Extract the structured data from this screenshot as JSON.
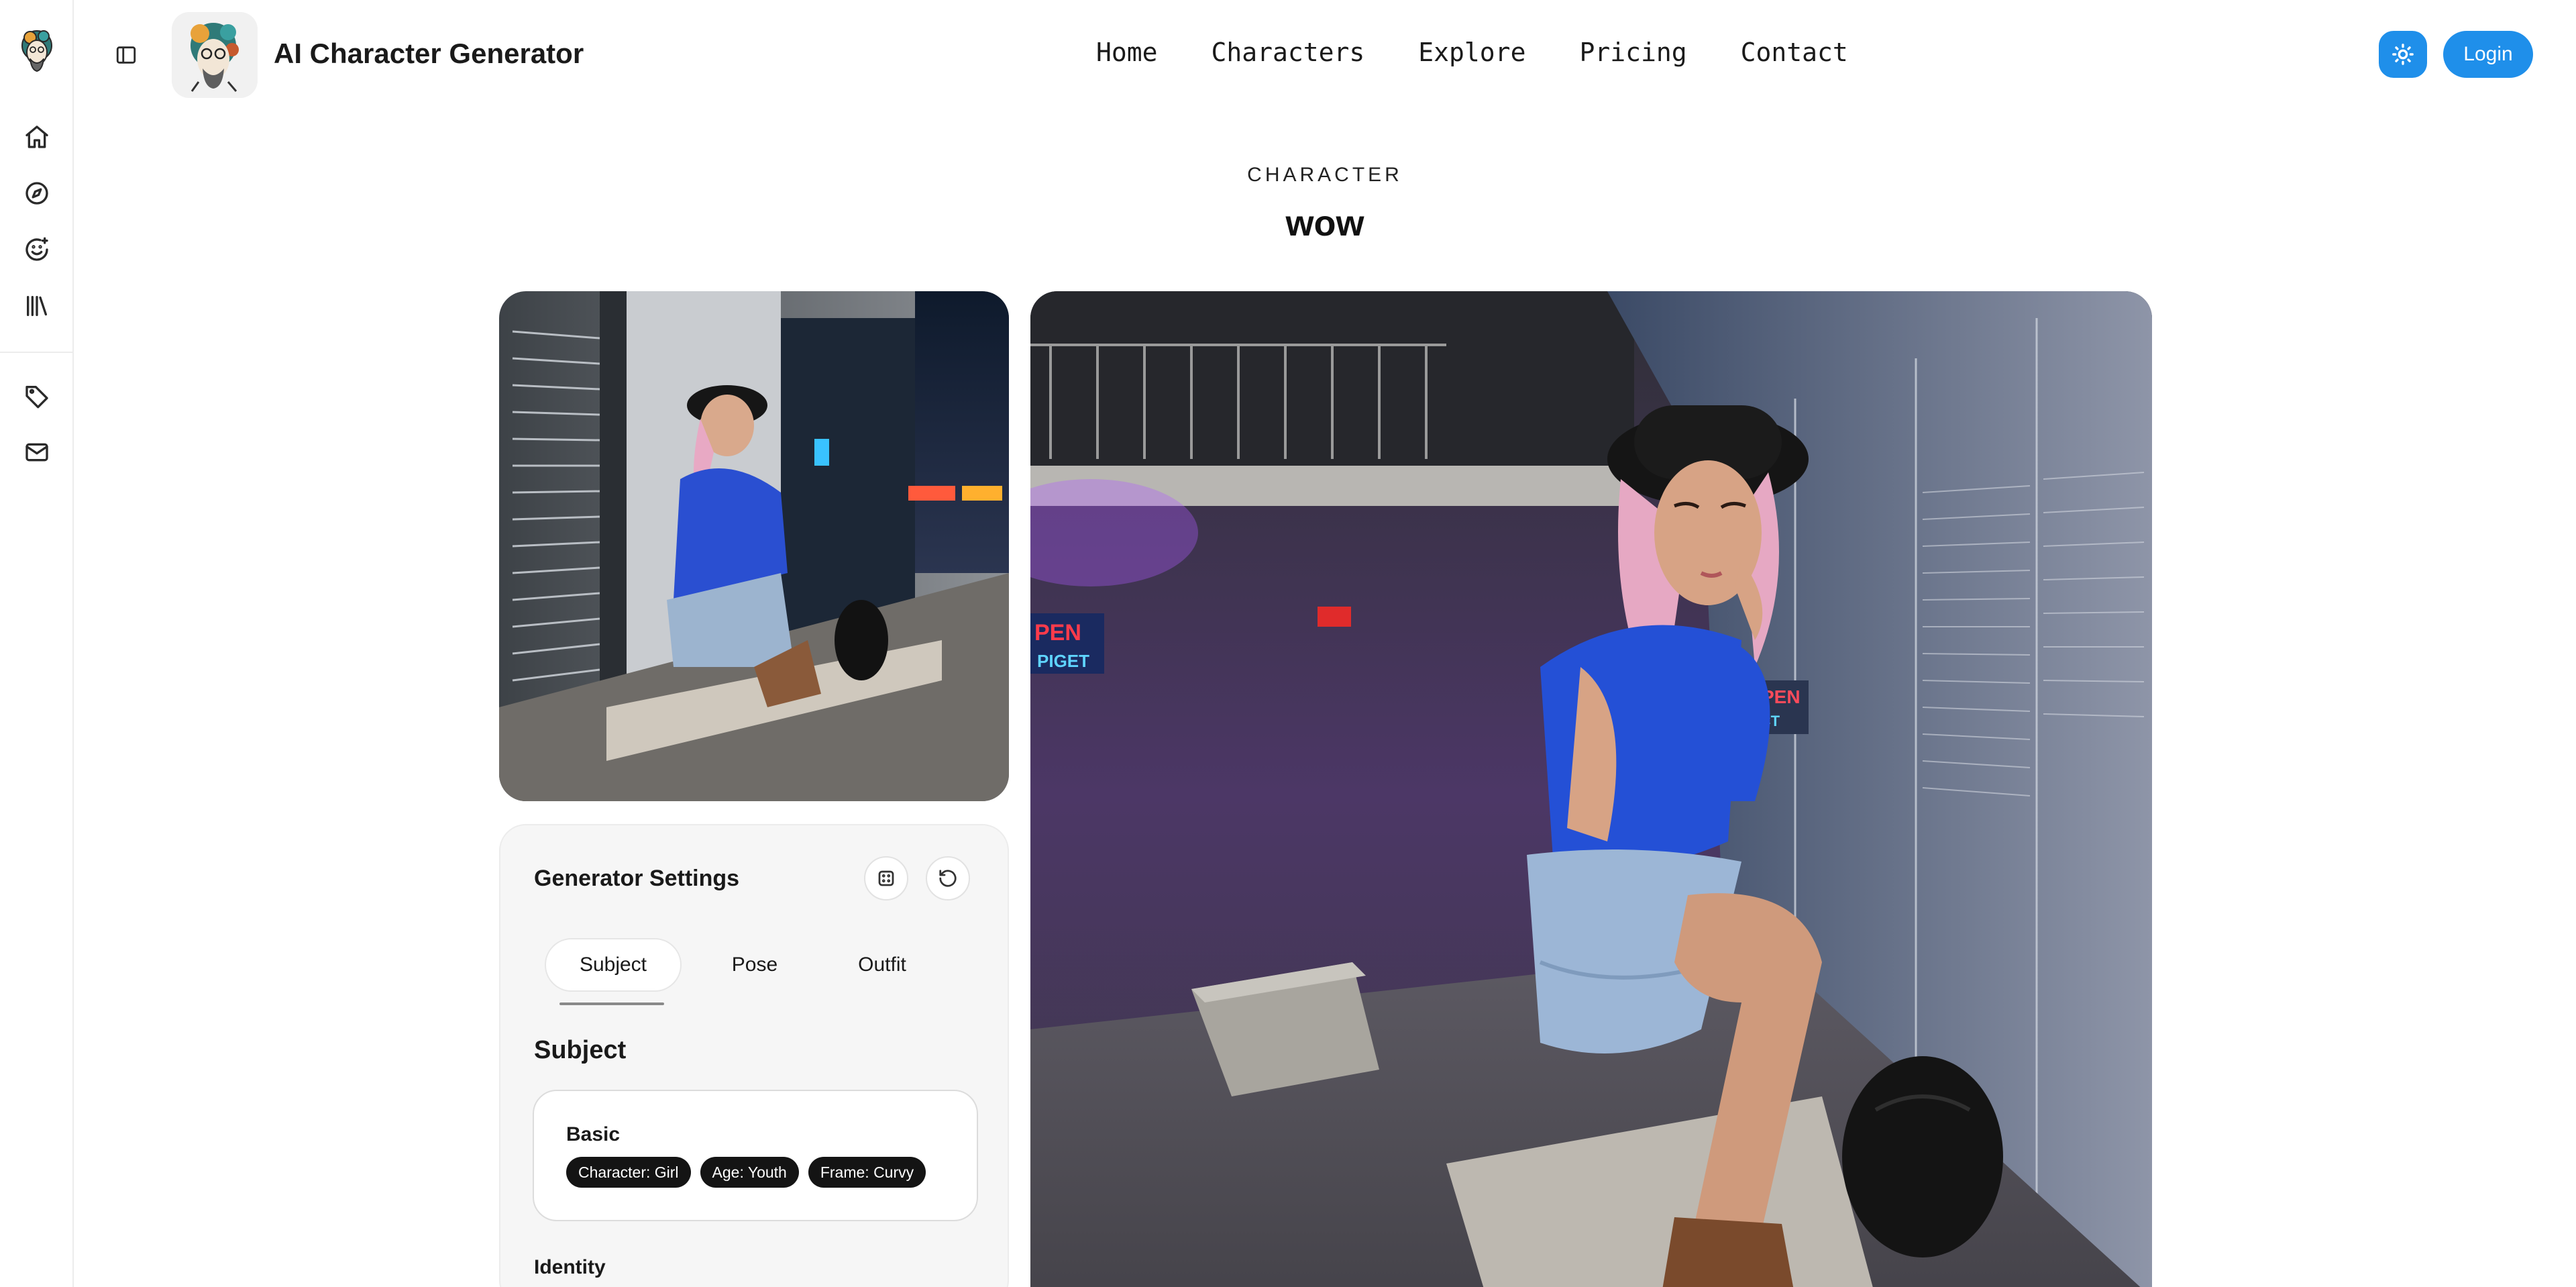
{
  "app": {
    "name": "AI Character Generator"
  },
  "rail": {
    "items": [
      {
        "icon": "home-icon"
      },
      {
        "icon": "compass-icon"
      },
      {
        "icon": "smile-plus-icon"
      },
      {
        "icon": "library-icon"
      },
      {
        "icon": "tag-icon"
      },
      {
        "icon": "mail-icon"
      }
    ]
  },
  "nav": {
    "items": [
      "Home",
      "Characters",
      "Explore",
      "Pricing",
      "Contact"
    ]
  },
  "header": {
    "login_label": "Login",
    "accent_color": "#1f8fea"
  },
  "page": {
    "eyebrow": "CHARACTER",
    "title": "wow"
  },
  "settings": {
    "title": "Generator Settings",
    "tabs": [
      "Subject",
      "Pose",
      "Outfit"
    ],
    "active_tab": "Subject",
    "section_title": "Subject",
    "basic": {
      "title": "Basic",
      "chips": [
        "Character: Girl",
        "Age: Youth",
        "Frame: Curvy"
      ]
    },
    "next_group_title": "Identity"
  }
}
